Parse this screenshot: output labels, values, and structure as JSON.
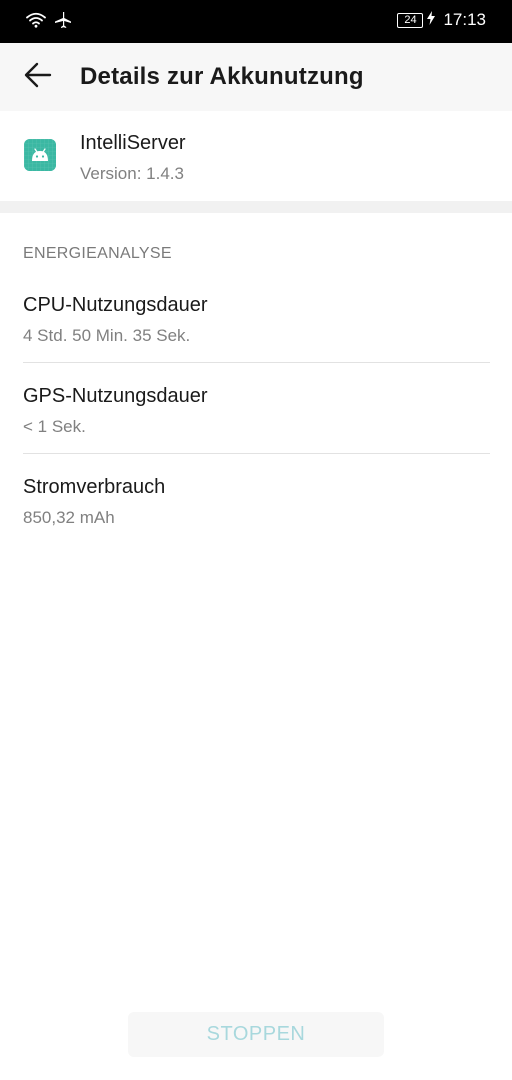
{
  "status_bar": {
    "battery_level": "24",
    "time": "17:13",
    "icons": [
      "wifi-icon",
      "airplane-icon",
      "battery-icon",
      "charging-icon"
    ]
  },
  "app_bar": {
    "title": "Details zur Akkunutzung",
    "back_icon": "back-arrow-icon"
  },
  "app_info": {
    "icon": "android-icon",
    "icon_color": "#3bb8a3",
    "name": "IntelliServer",
    "version": "Version: 1.4.3"
  },
  "energy_analysis": {
    "header": "ENERGIEANALYSE",
    "items": [
      {
        "title": "CPU-Nutzungsdauer",
        "value": "4 Std. 50 Min. 35 Sek."
      },
      {
        "title": "GPS-Nutzungsdauer",
        "value": "< 1 Sek."
      },
      {
        "title": "Stromverbrauch",
        "value": "850,32 mAh"
      }
    ]
  },
  "footer": {
    "stop_label": "STOPPEN",
    "stop_color": "#a8d8dd"
  }
}
